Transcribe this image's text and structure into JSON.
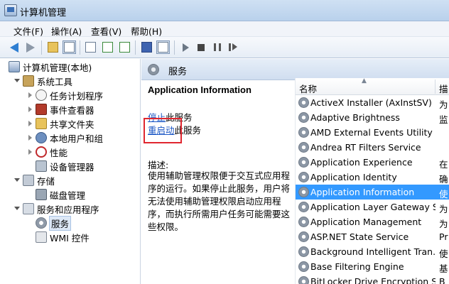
{
  "window": {
    "title": "计算机管理"
  },
  "menu": [
    "文件(F)",
    "操作(A)",
    "查看(V)",
    "帮助(H)"
  ],
  "tree": {
    "root": "计算机管理(本地)",
    "system_tools": "系统工具",
    "task_scheduler": "任务计划程序",
    "event_viewer": "事件查看器",
    "shared_folders": "共享文件夹",
    "local_users": "本地用户和组",
    "performance": "性能",
    "device_manager": "设备管理器",
    "storage": "存储",
    "disk_management": "磁盘管理",
    "services_apps": "服务和应用程序",
    "services": "服务",
    "wmi": "WMI 控件"
  },
  "services_header": "服务",
  "detail": {
    "title": "Application Information",
    "stop_link": "停止",
    "stop_suffix": "此服务",
    "restart_link": "重启动",
    "restart_suffix": "此服务",
    "desc_label": "描述:",
    "desc_text": "使用辅助管理权限便于交互式应用程序的运行。如果停止此服务，用户将无法使用辅助管理权限启动应用程序，而执行所需用户任务可能需要这些权限。"
  },
  "list": {
    "col_name": "名称",
    "col_desc": "描",
    "rows": [
      {
        "name": "ActiveX Installer (AxInstSV)",
        "desc": "为"
      },
      {
        "name": "Adaptive Brightness",
        "desc": "监"
      },
      {
        "name": "AMD External Events Utility",
        "desc": ""
      },
      {
        "name": "Andrea RT Filters Service",
        "desc": ""
      },
      {
        "name": "Application Experience",
        "desc": "在"
      },
      {
        "name": "Application Identity",
        "desc": "确"
      },
      {
        "name": "Application Information",
        "desc": "使"
      },
      {
        "name": "Application Layer Gateway S...",
        "desc": "为"
      },
      {
        "name": "Application Management",
        "desc": "为"
      },
      {
        "name": "ASP.NET State Service",
        "desc": "Pr"
      },
      {
        "name": "Background Intelligent Tran...",
        "desc": "使"
      },
      {
        "name": "Base Filtering Engine",
        "desc": "基"
      },
      {
        "name": "BitLocker Drive Encryption S...",
        "desc": "B"
      }
    ]
  },
  "colors": {
    "accent": "#3399ff",
    "link": "#1a56c4",
    "highlight_box": "#e0262f"
  }
}
